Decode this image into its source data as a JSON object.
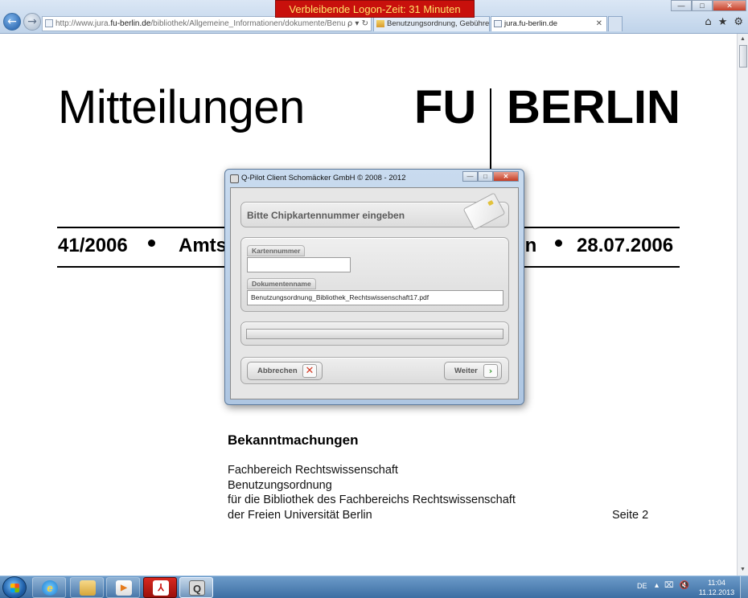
{
  "browser": {
    "address_prefix": "http://www.jura.",
    "address_host": "fu-berlin.de",
    "address_rest": "/bibliothek/Allgemeine_Informationen/dokumente/Benutzung",
    "address_tools": "ρ ▾ ↻",
    "tabs": [
      {
        "label": "Benutzungsordnung, Gebühre..."
      },
      {
        "label": "jura.fu-berlin.de",
        "close": "✕"
      }
    ],
    "logon_banner": "Verbleibende Logon-Zeit:   31   Minuten",
    "window_buttons": {
      "minimize": "—",
      "maximize": "□",
      "close": "✕"
    },
    "tool_icons": [
      "⌂",
      "★",
      "⚙"
    ],
    "back_icon": "←",
    "forward_icon": "→"
  },
  "document": {
    "title": "Mitteilungen",
    "logo_fu": "FU",
    "logo_berlin": "BERLIN",
    "issue": "41/2006",
    "amts_fragment": "Amts",
    "in_fragment": "in",
    "date": "28.07.2006",
    "section": "Bekanntmachungen",
    "lines": [
      "Fachbereich Rechtswissenschaft",
      "Benutzungsordnung",
      "für die Bibliothek des Fachbereichs Rechtswissenschaft",
      "der Freien Universität Berlin"
    ],
    "page_label": "Seite 2"
  },
  "dialog": {
    "title": "Q-Pilot Client Schomäcker GmbH © 2008 - 2012",
    "window_buttons": {
      "minimize": "—",
      "maximize": "□",
      "close": "✕"
    },
    "header": "Bitte Chipkartennummer eingeben",
    "card_number_label": "Kartennummer",
    "card_number_value": "",
    "document_name_label": "Dokumentenname",
    "document_name_value": "Benutzungsordnung_Bibliothek_Rechtswissenschaft17.pdf",
    "progress": 0,
    "cancel_label": "Abbrechen",
    "cancel_icon": "✕",
    "next_label": "Weiter",
    "next_icon": "›"
  },
  "taskbar": {
    "language": "DE",
    "tray_icons": [
      "▴",
      "⌧",
      "🔇"
    ],
    "time": "11:04",
    "date": "11.12.2013",
    "apps": [
      {
        "name": "internet-explorer",
        "glyph": "e"
      },
      {
        "name": "windows-explorer",
        "glyph": ""
      },
      {
        "name": "media-player",
        "glyph": "▶"
      },
      {
        "name": "adobe-reader",
        "glyph": "⅄"
      },
      {
        "name": "q-pilot-client",
        "glyph": "Q"
      }
    ]
  }
}
